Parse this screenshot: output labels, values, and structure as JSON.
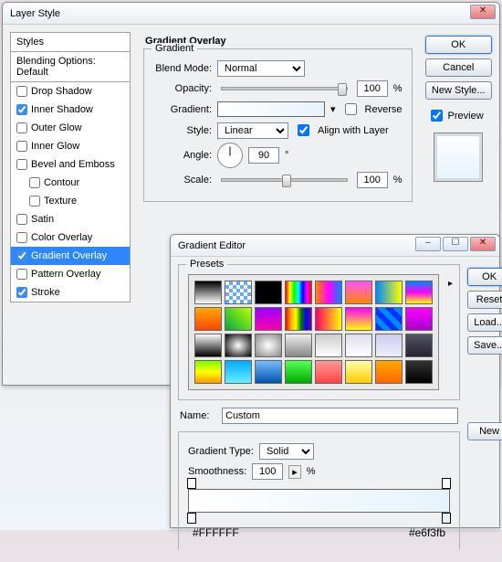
{
  "layerStyle": {
    "title": "Layer Style",
    "stylesHeader": "Styles",
    "blendingOptions": "Blending Options: Default",
    "styleRows": [
      "Drop Shadow",
      "Inner Shadow",
      "Outer Glow",
      "Inner Glow",
      "Bevel and Emboss",
      "Contour",
      "Texture",
      "Satin",
      "Color Overlay",
      "Gradient Overlay",
      "Pattern Overlay",
      "Stroke"
    ],
    "checked": {
      "Inner Shadow": true,
      "Gradient Overlay": true,
      "Stroke": true
    },
    "indent": {
      "Contour": true,
      "Texture": true
    },
    "selected": "Gradient Overlay",
    "sectionTitle": "Gradient Overlay",
    "gradientLegend": "Gradient",
    "blendModeLabel": "Blend Mode:",
    "blendModeValue": "Normal",
    "opacityLabel": "Opacity:",
    "opacityValue": "100",
    "pct": "%",
    "gradientLabel": "Gradient:",
    "reverseLabel": "Reverse",
    "styleLabel": "Style:",
    "styleValue": "Linear",
    "alignLabel": "Align with Layer",
    "angleLabel": "Angle:",
    "angleValue": "90",
    "deg": "°",
    "scaleLabel": "Scale:",
    "scaleValue": "100",
    "ok": "OK",
    "cancel": "Cancel",
    "newStyle": "New Style...",
    "previewLabel": "Preview"
  },
  "gradientEditor": {
    "title": "Gradient Editor",
    "presetsLabel": "Presets",
    "ok": "OK",
    "reset": "Reset",
    "load": "Load...",
    "save": "Save...",
    "new": "New",
    "nameLabel": "Name:",
    "nameValue": "Custom",
    "typeLabel": "Gradient Type:",
    "typeValue": "Solid",
    "smoothLabel": "Smoothness:",
    "smoothValue": "100",
    "pct": "%",
    "leftStop": "#FFFFFF",
    "rightStop": "#e6f3fb"
  },
  "winbtns": {
    "min": "–",
    "max": "☐",
    "close": "✕"
  }
}
